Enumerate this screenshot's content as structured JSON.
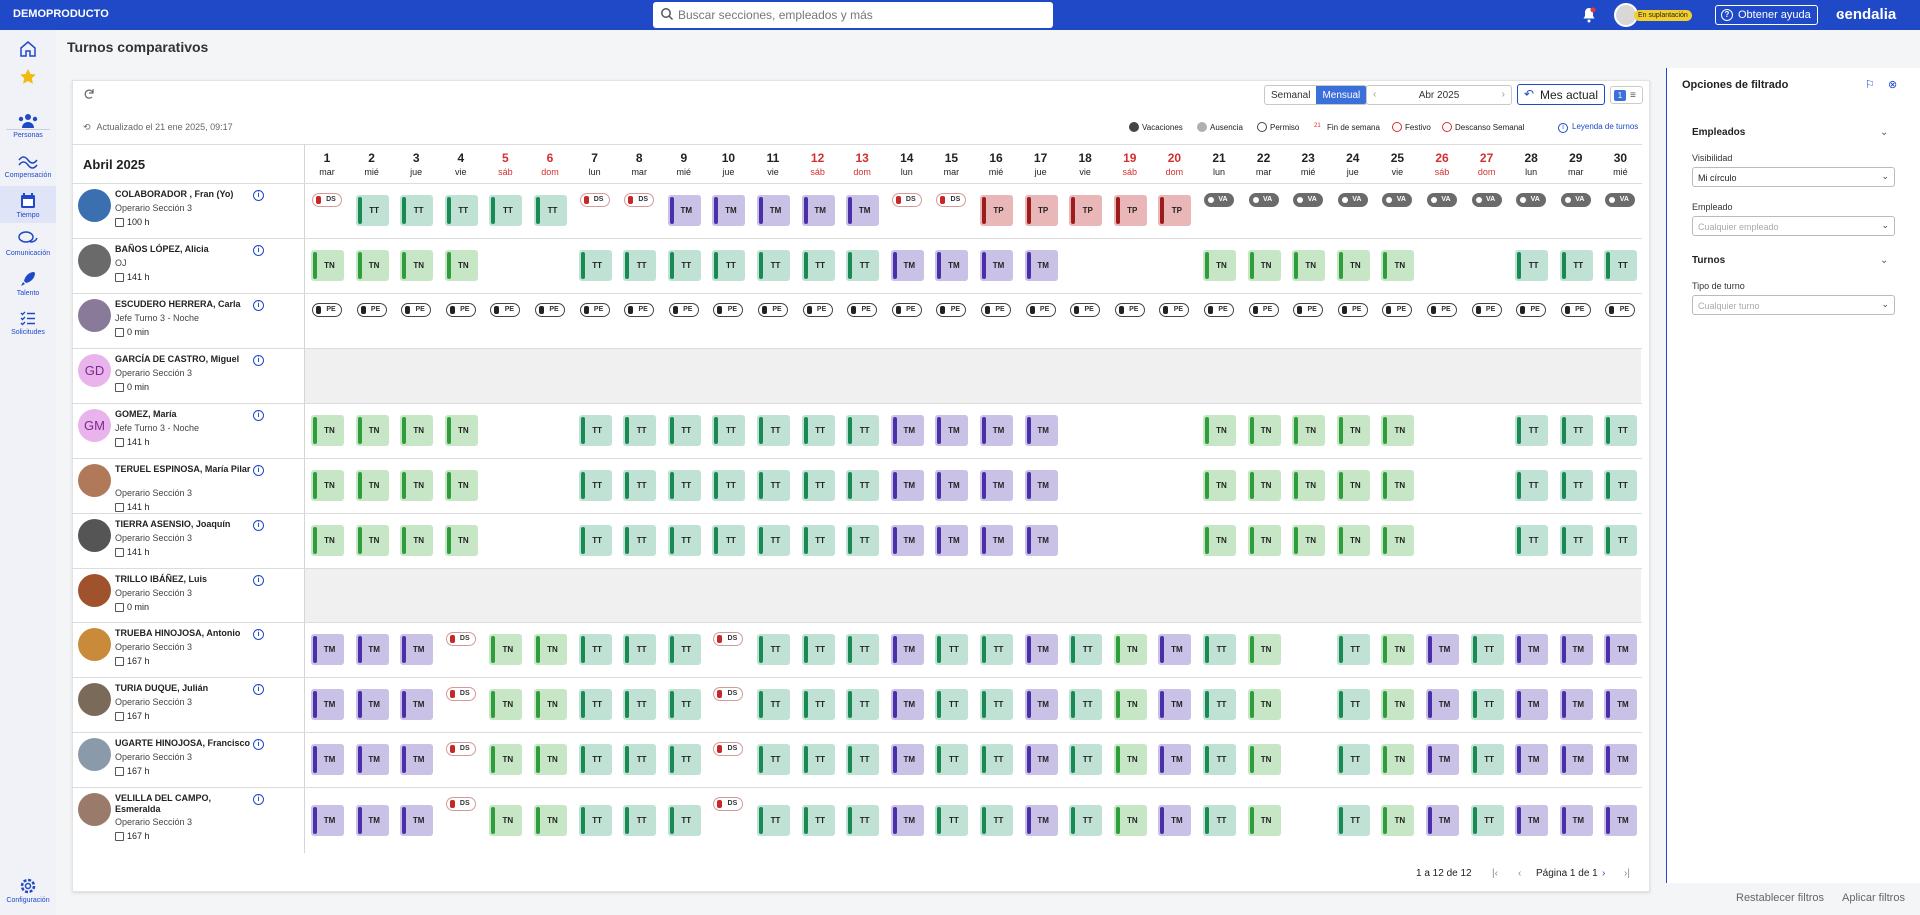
{
  "topbar": {
    "brand": "DEMOPRODUCTO",
    "search_placeholder": "Buscar secciones, empleados y más",
    "impersonation": "En suplantación",
    "help": "Obtener ayuda",
    "logo": "endalia"
  },
  "sidebar": [
    {
      "label": "",
      "icon": "home-icon"
    },
    {
      "label": "",
      "icon": "star-icon"
    },
    {
      "label": "Personas",
      "icon": "people-icon"
    },
    {
      "label": "Compensación",
      "icon": "compensation-icon"
    },
    {
      "label": "Tiempo",
      "icon": "calendar-icon"
    },
    {
      "label": "Comunicación",
      "icon": "chat-icon"
    },
    {
      "label": "Talento",
      "icon": "rocket-icon"
    },
    {
      "label": "Solicitudes",
      "icon": "list-icon"
    },
    {
      "label": "Configuración",
      "icon": "gear-icon"
    }
  ],
  "page": {
    "title": "Turnos comparativos"
  },
  "toolbar": {
    "weekly": "Semanal",
    "monthly": "Mensual",
    "month": "Abr 2025",
    "current": "Mes actual",
    "view_count": "1"
  },
  "updated": "Actualizado el 21 ene 2025, 09:17",
  "legend": [
    {
      "label": "Vacaciones",
      "color": "#444444"
    },
    {
      "label": "Ausencia",
      "color": "#b0b0b0"
    },
    {
      "label": "Permiso",
      "color": "#ffffff"
    },
    {
      "label": "Fin de semana",
      "color": "#d32f2f"
    },
    {
      "label": "Festivo",
      "color": "#ffffff"
    },
    {
      "label": "Descanso Semanal",
      "color": "#ffffff"
    }
  ],
  "legend_link": "Leyenda de turnos",
  "calendar": {
    "month_title": "Abril 2025",
    "days": [
      {
        "n": "1",
        "w": "mar",
        "we": false
      },
      {
        "n": "2",
        "w": "mié",
        "we": false
      },
      {
        "n": "3",
        "w": "jue",
        "we": false
      },
      {
        "n": "4",
        "w": "vie",
        "we": false
      },
      {
        "n": "5",
        "w": "sáb",
        "we": true
      },
      {
        "n": "6",
        "w": "dom",
        "we": true
      },
      {
        "n": "7",
        "w": "lun",
        "we": false
      },
      {
        "n": "8",
        "w": "mar",
        "we": false
      },
      {
        "n": "9",
        "w": "mié",
        "we": false
      },
      {
        "n": "10",
        "w": "jue",
        "we": false
      },
      {
        "n": "11",
        "w": "vie",
        "we": false
      },
      {
        "n": "12",
        "w": "sáb",
        "we": true
      },
      {
        "n": "13",
        "w": "dom",
        "we": true
      },
      {
        "n": "14",
        "w": "lun",
        "we": false
      },
      {
        "n": "15",
        "w": "mar",
        "we": false
      },
      {
        "n": "16",
        "w": "mié",
        "we": false
      },
      {
        "n": "17",
        "w": "jue",
        "we": false
      },
      {
        "n": "18",
        "w": "vie",
        "we": false
      },
      {
        "n": "19",
        "w": "sáb",
        "we": true
      },
      {
        "n": "20",
        "w": "dom",
        "we": true
      },
      {
        "n": "21",
        "w": "lun",
        "we": false
      },
      {
        "n": "22",
        "w": "mar",
        "we": false
      },
      {
        "n": "23",
        "w": "mié",
        "we": false
      },
      {
        "n": "24",
        "w": "jue",
        "we": false
      },
      {
        "n": "25",
        "w": "vie",
        "we": false
      },
      {
        "n": "26",
        "w": "sáb",
        "we": true
      },
      {
        "n": "27",
        "w": "dom",
        "we": true
      },
      {
        "n": "28",
        "w": "lun",
        "we": false
      },
      {
        "n": "29",
        "w": "mar",
        "we": false
      },
      {
        "n": "30",
        "w": "mié",
        "we": false
      }
    ]
  },
  "employees": [
    {
      "name": "COLABORADOR , Fran (Yo)",
      "role": "Operario Sección 3",
      "hours": "100 h",
      "initials": "",
      "av": "#3a6fb0",
      "shifts": [
        "DS",
        "TT",
        "TT",
        "TT",
        "TT",
        "TT",
        "DS",
        "DS",
        "TM",
        "TM",
        "TM",
        "TM",
        "TM",
        "DS",
        "DS",
        "TP",
        "TP",
        "TP",
        "TP",
        "TP",
        "VA",
        "VA",
        "VA",
        "VA",
        "VA",
        "VA",
        "VA",
        "VA",
        "VA",
        "VA"
      ]
    },
    {
      "name": "BAÑOS LÓPEZ, Alicia",
      "role": "OJ",
      "hours": "141 h",
      "initials": "",
      "av": "#6a6a6a",
      "shifts": [
        "TN",
        "TN",
        "TN",
        "TN",
        "",
        "",
        "TT",
        "TT",
        "TT",
        "TT",
        "TT",
        "TT",
        "TT",
        "TM",
        "TM",
        "TM",
        "TM",
        "",
        "",
        "",
        "TN",
        "TN",
        "TN",
        "TN",
        "TN",
        "",
        "",
        "TT",
        "TT",
        "TT"
      ]
    },
    {
      "name": "ESCUDERO HERRERA, Carla",
      "role": "Jefe Turno 3 - Noche",
      "hours": "0 min",
      "initials": "",
      "av": "#8a7a9a",
      "shifts": [
        "PE",
        "PE",
        "PE",
        "PE",
        "PE",
        "PE",
        "PE",
        "PE",
        "PE",
        "PE",
        "PE",
        "PE",
        "PE",
        "PE",
        "PE",
        "PE",
        "PE",
        "PE",
        "PE",
        "PE",
        "PE",
        "PE",
        "PE",
        "PE",
        "PE",
        "PE",
        "PE",
        "PE",
        "PE",
        "PE"
      ]
    },
    {
      "name": "GARCÍA DE CASTRO, Miguel",
      "role": "Operario Sección 3",
      "hours": "0 min",
      "initials": "GD",
      "av": "#e9b3ec",
      "shifts": [
        "",
        "",
        "",
        "",
        "",
        "",
        "",
        "",
        "",
        "",
        "",
        "",
        "",
        "",
        "",
        "",
        "",
        "",
        "",
        "",
        "",
        "",
        "",
        "",
        "",
        "",
        "",
        "",
        "",
        ""
      ]
    },
    {
      "name": "GOMEZ, María",
      "role": "Jefe Turno 3 - Noche",
      "hours": "141 h",
      "initials": "GM",
      "av": "#e9b3ec",
      "shifts": [
        "TN",
        "TN",
        "TN",
        "TN",
        "",
        "",
        "TT",
        "TT",
        "TT",
        "TT",
        "TT",
        "TT",
        "TT",
        "TM",
        "TM",
        "TM",
        "TM",
        "",
        "",
        "",
        "TN",
        "TN",
        "TN",
        "TN",
        "TN",
        "",
        "",
        "TT",
        "TT",
        "TT"
      ]
    },
    {
      "name": "TERUEL ESPINOSA, María Pilar",
      "role": "Operario Sección 3",
      "hours": "141 h",
      "initials": "",
      "av": "#b07a5a",
      "shifts": [
        "TN",
        "TN",
        "TN",
        "TN",
        "",
        "",
        "TT",
        "TT",
        "TT",
        "TT",
        "TT",
        "TT",
        "TT",
        "TM",
        "TM",
        "TM",
        "TM",
        "",
        "",
        "",
        "TN",
        "TN",
        "TN",
        "TN",
        "TN",
        "",
        "",
        "TT",
        "TT",
        "TT"
      ]
    },
    {
      "name": "TIERRA ASENSIO, Joaquín",
      "role": "Operario Sección 3",
      "hours": "141 h",
      "initials": "",
      "av": "#555555",
      "shifts": [
        "TN",
        "TN",
        "TN",
        "TN",
        "",
        "",
        "TT",
        "TT",
        "TT",
        "TT",
        "TT",
        "TT",
        "TT",
        "TM",
        "TM",
        "TM",
        "TM",
        "",
        "",
        "",
        "TN",
        "TN",
        "TN",
        "TN",
        "TN",
        "",
        "",
        "TT",
        "TT",
        "TT"
      ]
    },
    {
      "name": "TRILLO IBÁÑEZ, Luis",
      "role": "Operario Sección 3",
      "hours": "0 min",
      "initials": "",
      "av": "#a0522d",
      "shifts": [
        "",
        "",
        "",
        "",
        "",
        "",
        "",
        "",
        "",
        "",
        "",
        "",
        "",
        "",
        "",
        "",
        "",
        "",
        "",
        "",
        "",
        "",
        "",
        "",
        "",
        "",
        "",
        "",
        "",
        ""
      ]
    },
    {
      "name": "TRUEBA HINOJOSA, Antonio",
      "role": "Operario Sección 3",
      "hours": "167 h",
      "initials": "",
      "av": "#c98a3a",
      "shifts": [
        "TM",
        "TM",
        "TM",
        "DS",
        "TN",
        "TN",
        "TT",
        "TT",
        "TT",
        "DS",
        "TT",
        "TT",
        "TT",
        "TM",
        "TT",
        "TT",
        "TM",
        "TT",
        "TN",
        "TM",
        "TT",
        "TN",
        "",
        "TT",
        "TN",
        "TM",
        "TT",
        "TM",
        "TM",
        "TM"
      ]
    },
    {
      "name": "TURIA DUQUE, Julián",
      "role": "Operario Sección 3",
      "hours": "167 h",
      "initials": "",
      "av": "#7a6a5a",
      "shifts": [
        "TM",
        "TM",
        "TM",
        "DS",
        "TN",
        "TN",
        "TT",
        "TT",
        "TT",
        "DS",
        "TT",
        "TT",
        "TT",
        "TM",
        "TT",
        "TT",
        "TM",
        "TT",
        "TN",
        "TM",
        "TT",
        "TN",
        "",
        "TT",
        "TN",
        "TM",
        "TT",
        "TM",
        "TM",
        "TM"
      ]
    },
    {
      "name": "UGARTE HINOJOSA, Francisco",
      "role": "Operario Sección 3",
      "hours": "167 h",
      "initials": "",
      "av": "#8a9aaa",
      "shifts": [
        "TM",
        "TM",
        "TM",
        "DS",
        "TN",
        "TN",
        "TT",
        "TT",
        "TT",
        "DS",
        "TT",
        "TT",
        "TT",
        "TM",
        "TT",
        "TT",
        "TM",
        "TT",
        "TN",
        "TM",
        "TT",
        "TN",
        "",
        "TT",
        "TN",
        "TM",
        "TT",
        "TM",
        "TM",
        "TM"
      ]
    },
    {
      "name": "VELILLA DEL CAMPO, Esmeralda",
      "role": "Operario Sección 3",
      "hours": "167 h",
      "initials": "",
      "av": "#9a7a6a",
      "shifts": [
        "TM",
        "TM",
        "TM",
        "DS",
        "TN",
        "TN",
        "TT",
        "TT",
        "TT",
        "DS",
        "TT",
        "TT",
        "TT",
        "TM",
        "TT",
        "TT",
        "TM",
        "TT",
        "TN",
        "TM",
        "TT",
        "TN",
        "",
        "TT",
        "TN",
        "TM",
        "TT",
        "TM",
        "TM",
        "TM"
      ]
    }
  ],
  "pagination": {
    "range": "1 a 12 de 12",
    "page": "Página 1 de 1"
  },
  "filters": {
    "title": "Opciones de filtrado",
    "employees_section": "Empleados",
    "visibility_label": "Visibilidad",
    "visibility_value": "Mi círculo",
    "employee_label": "Empleado",
    "employee_placeholder": "Cualquier empleado",
    "shifts_section": "Turnos",
    "shift_type_label": "Tipo de turno",
    "shift_type_placeholder": "Cualquier turno",
    "reset": "Restablecer filtros",
    "apply": "Aplicar filtros"
  }
}
